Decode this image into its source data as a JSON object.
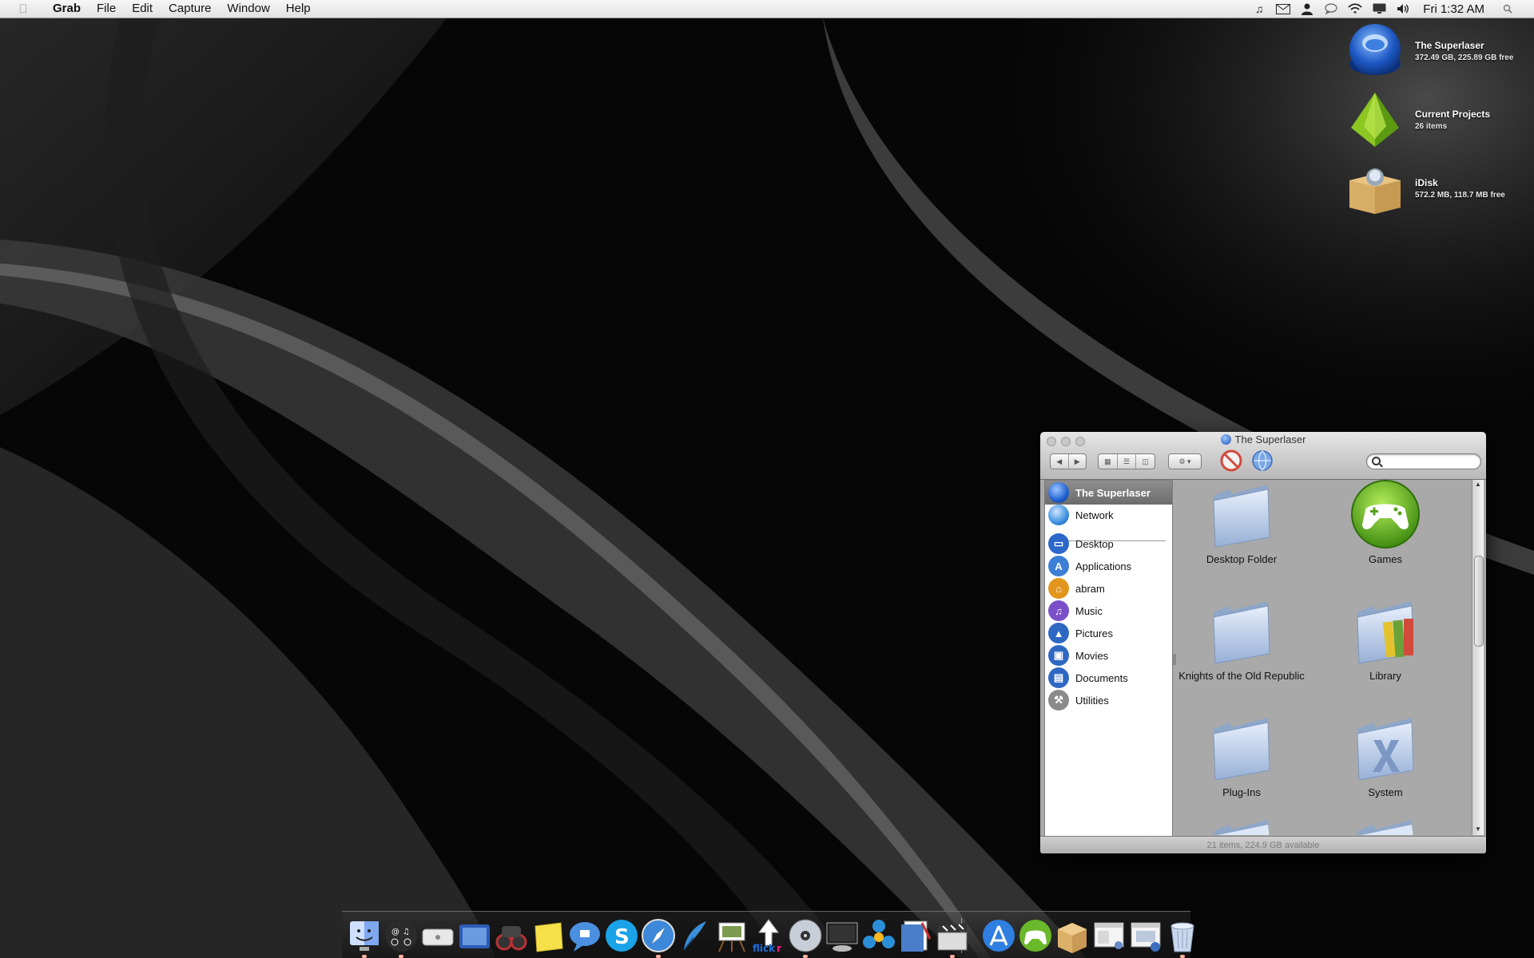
{
  "menubar": {
    "apple_glyph": "",
    "items": [
      "Grab",
      "File",
      "Edit",
      "Capture",
      "Window",
      "Help"
    ],
    "status_icons": [
      "music-note-icon",
      "mail-icon",
      "user-icon",
      "chat-icon",
      "wifi-icon",
      "display-icon",
      "volume-icon"
    ],
    "clock": "Fri 1:32 AM"
  },
  "desktop_icons": [
    {
      "name": "The Superlaser",
      "info": "372.49 GB, 225.89 GB free",
      "icon": "hard-disk-icon"
    },
    {
      "name": "Current Projects",
      "info": "26 items",
      "icon": "pyramid-folder-icon"
    },
    {
      "name": "iDisk",
      "info": "572.2 MB, 118.7 MB free",
      "icon": "idisk-box-icon"
    }
  ],
  "finder": {
    "title": "The Superlaser",
    "sidebar": [
      {
        "label": "The Superlaser",
        "icon": "hard-disk-icon",
        "color": "#1f5fd0",
        "selected": true
      },
      {
        "label": "Network",
        "icon": "globe-icon",
        "color": "#3b8fe0"
      },
      {
        "label": "Desktop",
        "icon": "desktop-icon",
        "color": "#2c67c9"
      },
      {
        "label": "Applications",
        "icon": "applications-icon",
        "color": "#3d7fd6"
      },
      {
        "label": "abram",
        "icon": "home-icon",
        "color": "#e3961c"
      },
      {
        "label": "Music",
        "icon": "music-icon",
        "color": "#7b4fc8"
      },
      {
        "label": "Pictures",
        "icon": "pictures-icon",
        "color": "#2e68c2"
      },
      {
        "label": "Movies",
        "icon": "movies-icon",
        "color": "#2e68c2"
      },
      {
        "label": "Documents",
        "icon": "documents-icon",
        "color": "#2e68c2"
      },
      {
        "label": "Utilities",
        "icon": "utilities-icon",
        "color": "#7a7a7a"
      }
    ],
    "items": [
      {
        "label": "Desktop Folder",
        "icon": "folder-icon"
      },
      {
        "label": "Games",
        "icon": "games-controller-icon"
      },
      {
        "label": "Knights of the Old Republic",
        "icon": "folder-icon"
      },
      {
        "label": "Library",
        "icon": "library-folder-icon"
      },
      {
        "label": "Plug-Ins",
        "icon": "folder-icon"
      },
      {
        "label": "System",
        "icon": "system-folder-icon"
      }
    ],
    "status": "21 items, 224.9 GB available"
  },
  "dock": {
    "icons": [
      "finder-icon",
      "dashboard-widgets-icon",
      "mac-mini-icon",
      "photo-booth-icon",
      "binoculars-icon",
      "stickies-icon",
      "ichat-icon",
      "skype-icon",
      "safari-icon",
      "feather-quill-icon",
      "preview-easel-icon",
      "flickr-uploader-icon",
      "dvd-player-icon",
      "front-row-icon",
      "colloquy-icon",
      "textedit-icon",
      "movie-clapper-icon",
      "app-store-icon",
      "games-icon",
      "package-box-icon",
      "window-screenshot-icon",
      "grab-icon",
      "trash-icon"
    ]
  }
}
